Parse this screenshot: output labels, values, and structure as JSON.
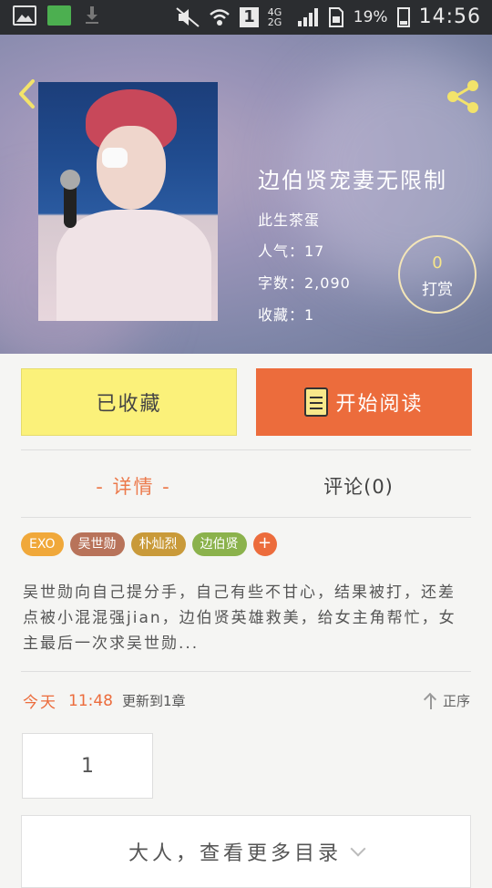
{
  "status_bar": {
    "battery": "19%",
    "time": "14:56",
    "sim": "1",
    "network": "4G 2G"
  },
  "book": {
    "title": "边伯贤宠妻无限制",
    "author": "此生茶蛋",
    "popularity": "人气：17",
    "word_count": "字数：2,090",
    "favorites": "收藏：1",
    "tip_count": "0",
    "tip_label": "打赏"
  },
  "actions": {
    "favorite_label": "已收藏",
    "read_label": "开始阅读"
  },
  "tabs": {
    "detail": "- 详情 -",
    "comments": "评论(0)"
  },
  "tags": [
    {
      "label": "EXO",
      "color": "#f0a83a"
    },
    {
      "label": "吴世勋",
      "color": "#b8735a"
    },
    {
      "label": "朴灿烈",
      "color": "#c99a3a"
    },
    {
      "label": "边伯贤",
      "color": "#8bb24c"
    }
  ],
  "tag_add": "+",
  "description": "吴世勋向自己提分手，自己有些不甘心，结果被打，还差点被小混混强jian，边伯贤英雄救美，给女主角帮忙，女主最后一次求吴世勋...",
  "update": {
    "day": "今天",
    "time": "11:48",
    "text": "更新到1章"
  },
  "sort_label": "正序",
  "chapters": [
    "1"
  ],
  "more_catalog": "大人，查看更多目录",
  "colors": {
    "accent": "#ec6c3c",
    "favorite_bg": "#fbf17a"
  }
}
